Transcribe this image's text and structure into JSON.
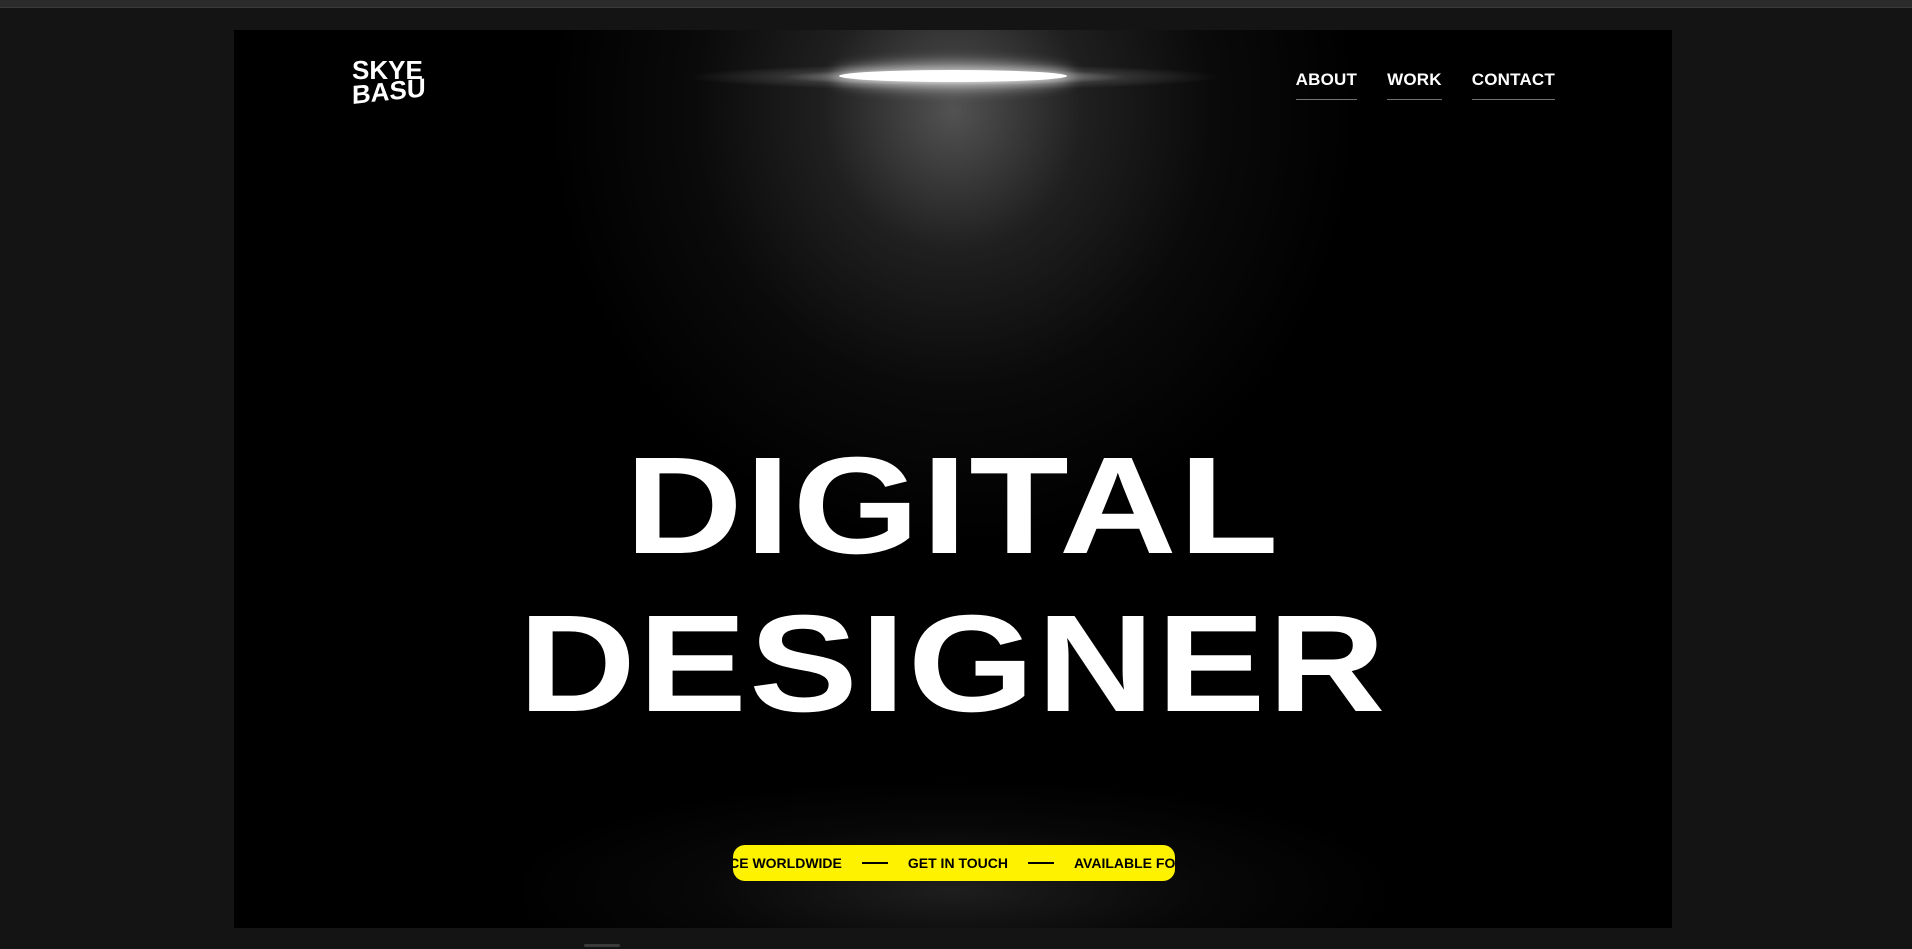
{
  "logo": {
    "line1": "SKYE",
    "line2": "BASU"
  },
  "nav": {
    "items": [
      {
        "label": "ABOUT"
      },
      {
        "label": "WORK"
      },
      {
        "label": "CONTACT"
      }
    ]
  },
  "hero": {
    "line1": "DIGITAL",
    "line2": "DESIGNER"
  },
  "ticker": {
    "items": [
      "NCE WORLDWIDE",
      "GET IN TOUCH",
      "AVAILABLE FOR"
    ],
    "background": "#fff200"
  },
  "colors": {
    "page_background": "#141414",
    "stage_background": "#000000",
    "text": "#ffffff",
    "accent": "#fff200"
  }
}
